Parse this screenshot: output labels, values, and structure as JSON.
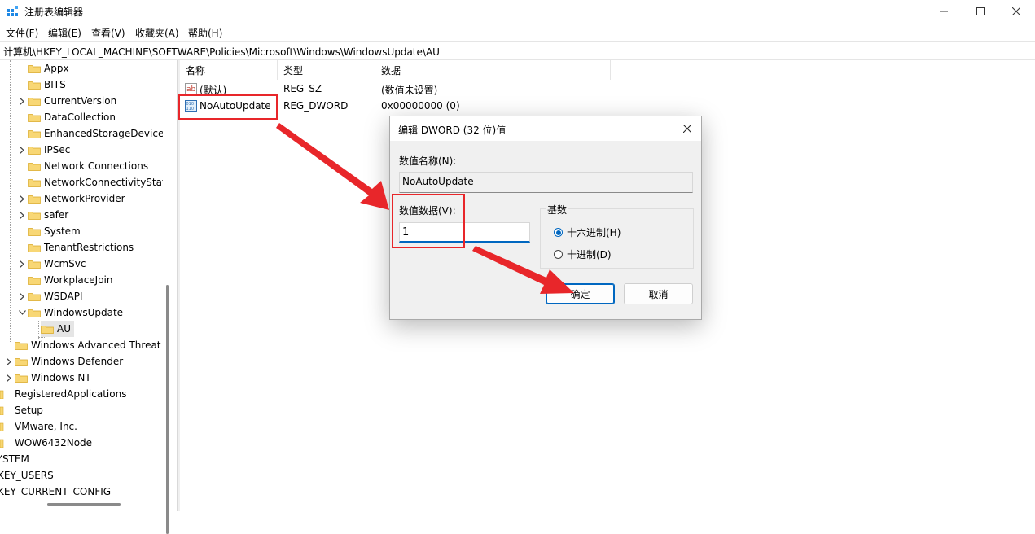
{
  "window": {
    "title": "注册表编辑器",
    "controls": [
      "minimize-icon",
      "maximize-icon",
      "close-icon"
    ]
  },
  "menu": [
    "文件(F)",
    "编辑(E)",
    "查看(V)",
    "收藏夹(A)",
    "帮助(H)"
  ],
  "address": "计算机\\HKEY_LOCAL_MACHINE\\SOFTWARE\\Policies\\Microsoft\\Windows\\WindowsUpdate\\AU",
  "tree": {
    "items": [
      {
        "label": "Appx",
        "expandable": false
      },
      {
        "label": "BITS",
        "expandable": false
      },
      {
        "label": "CurrentVersion",
        "expandable": true
      },
      {
        "label": "DataCollection",
        "expandable": false
      },
      {
        "label": "EnhancedStorageDevices",
        "expandable": false
      },
      {
        "label": "IPSec",
        "expandable": true
      },
      {
        "label": "Network Connections",
        "expandable": false
      },
      {
        "label": "NetworkConnectivityStatusIndicator",
        "expandable": false
      },
      {
        "label": "NetworkProvider",
        "expandable": true
      },
      {
        "label": "safer",
        "expandable": true
      },
      {
        "label": "System",
        "expandable": false
      },
      {
        "label": "TenantRestrictions",
        "expandable": false
      },
      {
        "label": "WcmSvc",
        "expandable": true
      },
      {
        "label": "WorkplaceJoin",
        "expandable": false
      },
      {
        "label": "WSDAPI",
        "expandable": true
      },
      {
        "label": "WindowsUpdate",
        "expandable": true,
        "expanded": true
      },
      {
        "label": "AU",
        "selected": true
      },
      {
        "label": "Windows Advanced Threat Protection",
        "expandable": false
      },
      {
        "label": "Windows Defender",
        "expandable": true
      },
      {
        "label": "Windows NT",
        "expandable": true
      },
      {
        "label": "RegisteredApplications"
      },
      {
        "label": "Setup"
      },
      {
        "label": "VMware, Inc."
      },
      {
        "label": "WOW6432Node"
      },
      {
        "label": "SYSTEM"
      },
      {
        "label": "HKEY_USERS"
      },
      {
        "label": "HKEY_CURRENT_CONFIG"
      }
    ]
  },
  "list": {
    "columns": [
      "名称",
      "类型",
      "数据"
    ],
    "rows": [
      {
        "icon": "string-value-icon",
        "name": "(默认)",
        "type": "REG_SZ",
        "data": "(数值未设置)"
      },
      {
        "icon": "binary-value-icon",
        "name": "NoAutoUpdate",
        "type": "REG_DWORD",
        "data": "0x00000000 (0)"
      }
    ]
  },
  "dialog": {
    "title": "编辑 DWORD (32 位)值",
    "name_label": "数值名称(N):",
    "name_value": "NoAutoUpdate",
    "data_label": "数值数据(V):",
    "data_value": "1",
    "base_label": "基数",
    "base_options": [
      {
        "label": "十六进制(H)",
        "selected": true
      },
      {
        "label": "十进制(D)",
        "selected": false
      }
    ],
    "ok_label": "确定",
    "cancel_label": "取消"
  },
  "annotation_color": "#e8262a",
  "accent_color": "#0067c0",
  "folder_color": "#f8d775"
}
